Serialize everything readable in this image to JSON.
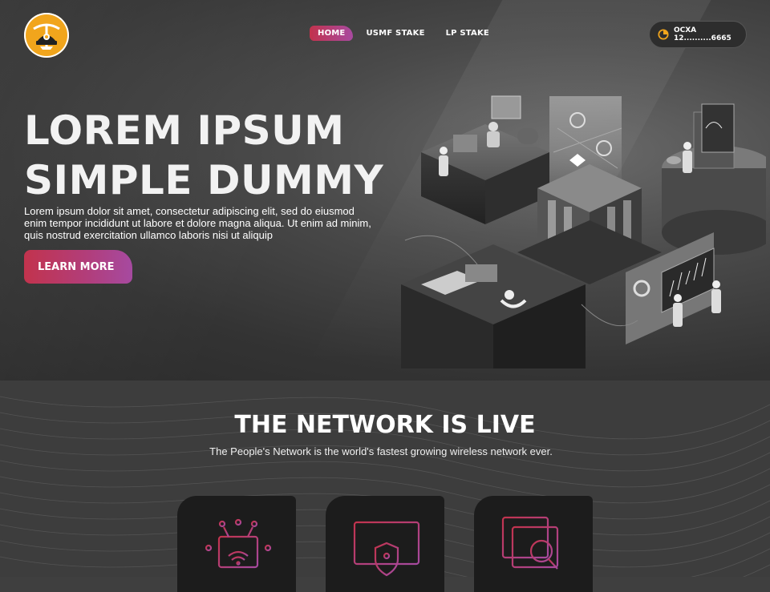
{
  "nav": {
    "items": [
      {
        "label": "HOME",
        "active": true
      },
      {
        "label": "USMF STAKE",
        "active": false
      },
      {
        "label": "LP STAKE",
        "active": false
      }
    ]
  },
  "wallet": {
    "address": "OCXA 12..........6665",
    "icon": "pie-chart-icon"
  },
  "hero": {
    "title_line1": "LOREM IPSUM",
    "title_line2": "SIMPLE DUMMY",
    "description": "Lorem ipsum dolor sit amet, consectetur adipiscing elit, sed do eiusmod enim tempor incididunt ut labore et dolore magna aliqua. Ut enim ad minim, quis nostrud exercitation ullamco laboris nisi ut aliquip",
    "button_label": "LEARN MORE"
  },
  "network": {
    "title": "THE NETWORK IS LIVE",
    "subtitle": "The People's Network is the world's fastest growing wireless network ever.",
    "cards": [
      {
        "icon": "iot-chip-wifi-icon"
      },
      {
        "icon": "secure-card-icon"
      },
      {
        "icon": "data-analytics-icon"
      }
    ]
  },
  "colors": {
    "accent_start": "#c2334d",
    "accent_end": "#a64aa0",
    "logo_bg": "#f1a51c",
    "background": "#3d3d3d"
  }
}
